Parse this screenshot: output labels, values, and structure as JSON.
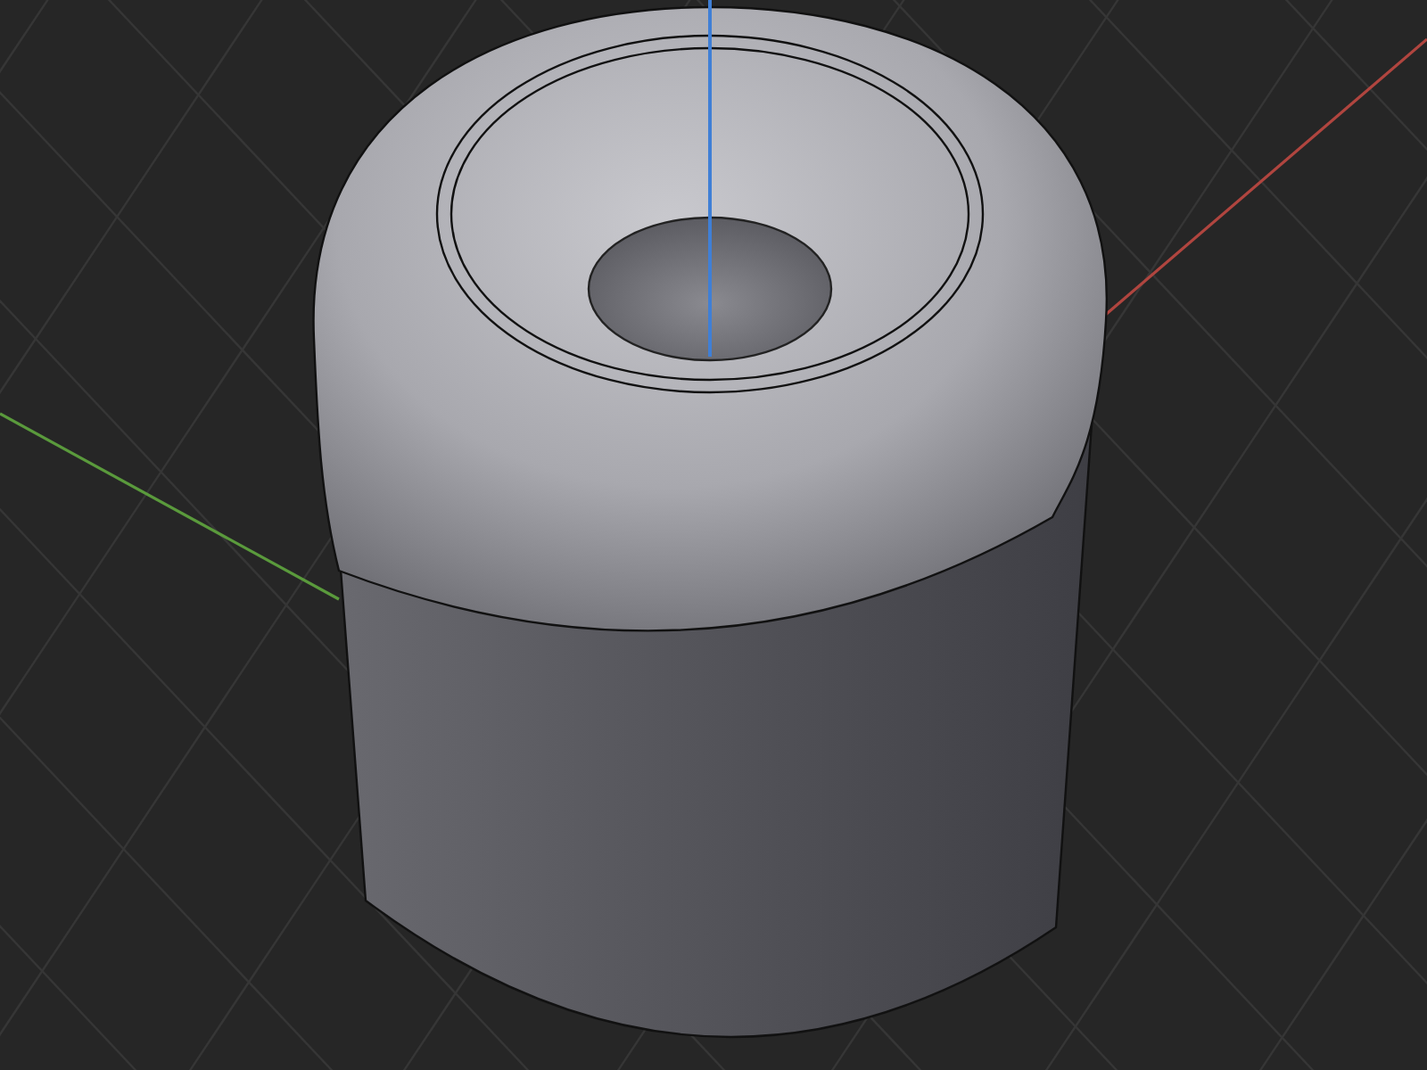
{
  "viewport": {
    "axes": [
      {
        "kind": "x",
        "color": "#b0453f"
      },
      {
        "kind": "y",
        "color": "#5a9a3c"
      },
      {
        "kind": "z",
        "color": "#3f7fd6"
      }
    ]
  }
}
